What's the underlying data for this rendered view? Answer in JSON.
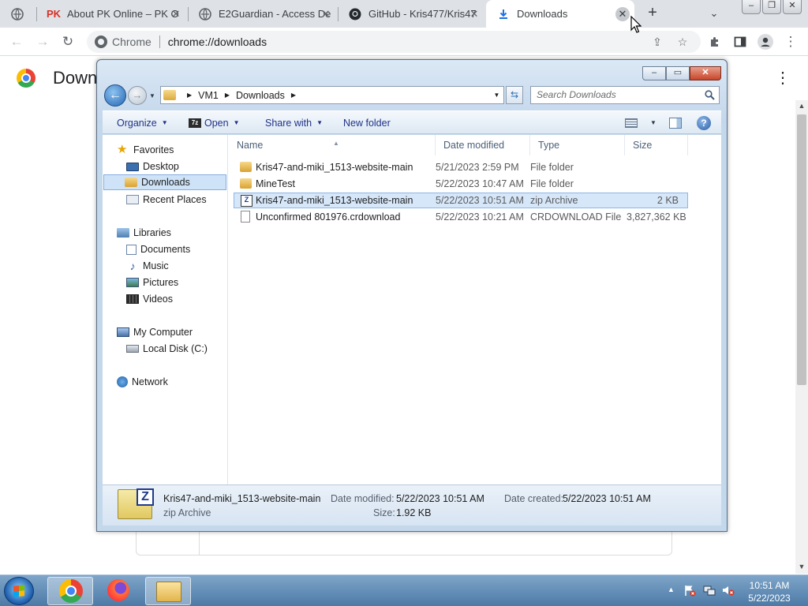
{
  "browser": {
    "tabs": [
      {
        "title": "About PK Online – PK O",
        "favicon": "pk-icon",
        "active": false
      },
      {
        "title": "E2Guardian - Access De",
        "favicon": "globe-icon",
        "active": false
      },
      {
        "title": "GitHub - Kris477/Kris47",
        "favicon": "github-icon",
        "active": false
      },
      {
        "title": "Downloads",
        "favicon": "download-icon",
        "active": true
      }
    ],
    "new_tab": "+",
    "omnibox": {
      "site": "Chrome",
      "url": "chrome://downloads"
    },
    "page": {
      "title": "Down"
    }
  },
  "explorer": {
    "address": {
      "crumbs": [
        "VM1",
        "Downloads"
      ]
    },
    "search": {
      "placeholder": "Search Downloads"
    },
    "commands": {
      "organize": "Organize",
      "open": "Open",
      "share_with": "Share with",
      "new_folder": "New folder"
    },
    "nav": {
      "favorites": "Favorites",
      "desktop": "Desktop",
      "downloads": "Downloads",
      "recent_places": "Recent Places",
      "libraries": "Libraries",
      "documents": "Documents",
      "music": "Music",
      "pictures": "Pictures",
      "videos": "Videos",
      "my_computer": "My Computer",
      "local_disk": "Local Disk (C:)",
      "network": "Network"
    },
    "columns": {
      "name": "Name",
      "date": "Date modified",
      "type": "Type",
      "size": "Size"
    },
    "files": [
      {
        "name": "Kris47-and-miki_1513-website-main",
        "date": "5/21/2023 2:59 PM",
        "type": "File folder",
        "size": "",
        "icon": "folder-icon"
      },
      {
        "name": "MineTest",
        "date": "5/22/2023 10:47 AM",
        "type": "File folder",
        "size": "",
        "icon": "folder-icon"
      },
      {
        "name": "Kris47-and-miki_1513-website-main",
        "date": "5/22/2023 10:51 AM",
        "type": "zip Archive",
        "size": "2 KB",
        "icon": "zip-icon"
      },
      {
        "name": "Unconfirmed 801976.crdownload",
        "date": "5/22/2023 10:21 AM",
        "type": "CRDOWNLOAD File",
        "size": "3,827,362 KB",
        "icon": "file-icon"
      }
    ],
    "details": {
      "name": "Kris47-and-miki_1513-website-main",
      "kind": "zip Archive",
      "modified_label": "Date modified:",
      "modified": "5/22/2023 10:51 AM",
      "created_label": "Date created:",
      "created": "5/22/2023 10:51 AM",
      "size_label": "Size:",
      "size": "1.92 KB"
    }
  },
  "taskbar": {
    "time": "10:51 AM",
    "date": "5/22/2023"
  },
  "colors": {
    "tabstrip": "#dee1e6",
    "explorer_frame": "#c4d8ec",
    "taskbar": "#4c7aa6",
    "selection": "#d6e7fa"
  }
}
